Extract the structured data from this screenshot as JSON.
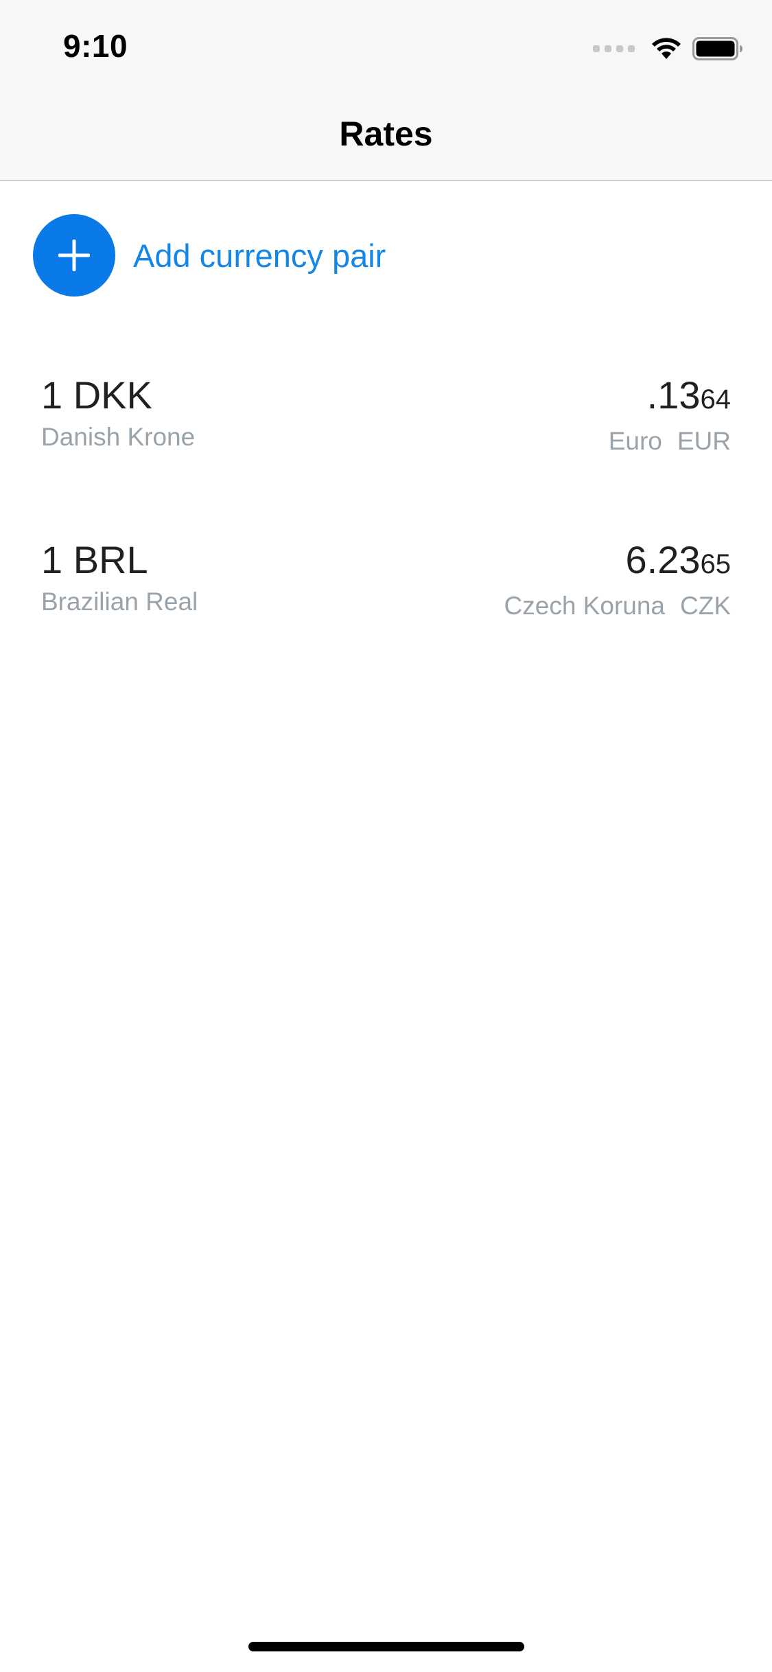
{
  "status_bar": {
    "time": "9:10",
    "icons": [
      "cellular-signal-icon",
      "wifi-icon",
      "battery-icon"
    ]
  },
  "nav": {
    "title": "Rates"
  },
  "add_pair": {
    "icon": "plus-icon",
    "label": "Add currency pair"
  },
  "rates": [
    {
      "base_amount": "1 DKK",
      "base_name": "Danish Krone",
      "rate_main": ".13",
      "rate_small": "64",
      "quote_name": "Euro",
      "quote_code": "EUR"
    },
    {
      "base_amount": "1 BRL",
      "base_name": "Brazilian Real",
      "rate_main": "6.23",
      "rate_small": "65",
      "quote_name": "Czech Koruna",
      "quote_code": "CZK"
    }
  ],
  "colors": {
    "accent": "#0a7ae8",
    "link_text": "#1486e8",
    "primary_text": "#1f2024",
    "secondary_text": "#9aa2aa",
    "nav_background": "#f7f7f7"
  }
}
